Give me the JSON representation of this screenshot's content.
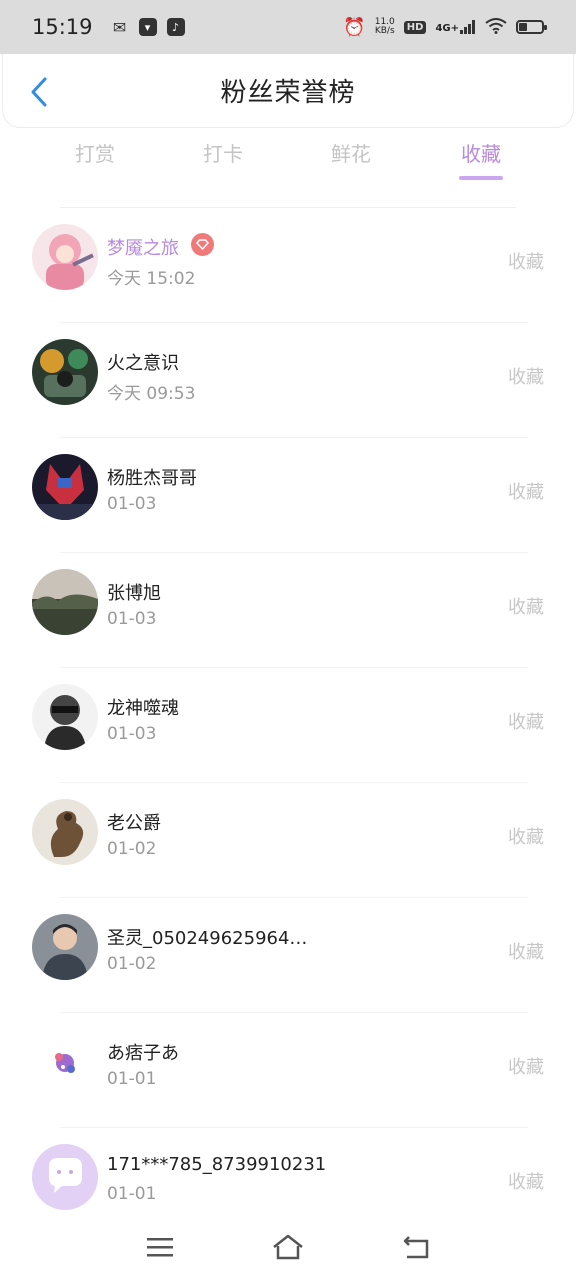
{
  "status_bar": {
    "time": "15:19",
    "apps": [
      "wechat-icon",
      "mail-icon",
      "tiktok-icon"
    ],
    "net_speed_value": "11.0",
    "net_speed_unit": "KB/s",
    "hd": "HD",
    "network": "4G+"
  },
  "header": {
    "title": "粉丝荣誉榜"
  },
  "tabs": [
    {
      "label": "打赏",
      "active": false
    },
    {
      "label": "打卡",
      "active": false
    },
    {
      "label": "鲜花",
      "active": false
    },
    {
      "label": "收藏",
      "active": true
    }
  ],
  "list": [
    {
      "name": "梦魇之旅",
      "time": "今天 15:02",
      "action": "收藏",
      "highlight": true,
      "badge": "diamond-icon"
    },
    {
      "name": "火之意识",
      "time": "今天 09:53",
      "action": "收藏"
    },
    {
      "name": "杨胜杰哥哥",
      "time": "01-03",
      "action": "收藏"
    },
    {
      "name": "张博旭",
      "time": "01-03",
      "action": "收藏"
    },
    {
      "name": "龙神噬魂",
      "time": "01-03",
      "action": "收藏"
    },
    {
      "name": "老公爵",
      "time": "01-02",
      "action": "收藏"
    },
    {
      "name": "圣灵_050249625964…",
      "time": "01-02",
      "action": "收藏"
    },
    {
      "name": "あ痞子あ",
      "time": "01-01",
      "action": "收藏"
    },
    {
      "name": "171***785_8739910231",
      "time": "01-01",
      "action": "收藏"
    }
  ],
  "colors": {
    "accent": "#b98ae0",
    "inactive_tab": "#c4c4c4",
    "secondary_text": "#9a9a9a",
    "back_arrow": "#2f8de4"
  }
}
